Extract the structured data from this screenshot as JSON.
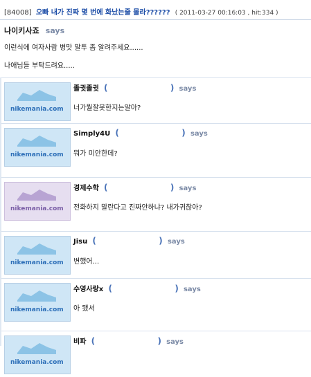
{
  "post": {
    "id": "[84008]",
    "title": "오빠 내가 진짜 몇 번에 화났는줄 몰라??????",
    "meta": "( 2011-03-27 00:16:03 , hit:334 )",
    "author": "나이키사죠",
    "says": "says",
    "lines": [
      "이런식에 여자사람 병맛 말투 좀 알려주세요......",
      "나애님들 부탁드려요....."
    ]
  },
  "comments": [
    {
      "author": "졸귓졸귓",
      "text": "너가뭘잘못한지는알아?",
      "avatar": "nikemania.com"
    },
    {
      "author": "Simply4U",
      "text": "뭐가 미안한데?",
      "avatar": "nikemania.com"
    },
    {
      "author": "경제수학",
      "text": "전화하지 말란다고 진짜안하냐? 내가귀찮아?",
      "avatar": "nikemania.com"
    },
    {
      "author": "Jisu",
      "text": "변했어...",
      "avatar": "nikemania.com"
    },
    {
      "author": "수영사랑x",
      "text": "아 됐서",
      "avatar": "nikemania.com"
    },
    {
      "author": "비파",
      "text": "",
      "avatar": "nikemania.com"
    }
  ],
  "labels": {
    "open_paren": "(",
    "close_paren": ")",
    "says": "says"
  },
  "colors": {
    "title": "#1f4fa8",
    "says": "#7b8aa6",
    "avatar_bg": "#cfe6f6",
    "avatar_alt_bg": "#e6def0"
  }
}
